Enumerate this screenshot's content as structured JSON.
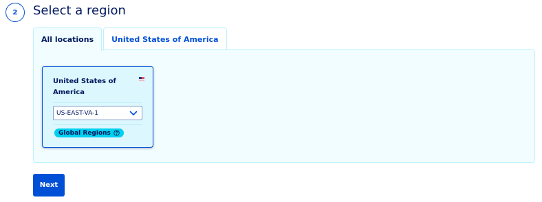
{
  "step": {
    "number": "2",
    "title": "Select a region"
  },
  "tabs": [
    {
      "label": "All locations",
      "active": true
    },
    {
      "label": "United States of America",
      "active": false
    }
  ],
  "region_card": {
    "title": "United States of America",
    "flag_icon": "us-flag-icon",
    "selected_value": "US-EAST-VA-1",
    "dropdown_icon": "chevron-down-icon",
    "badge_label": "Global Regions",
    "badge_icon": "question-circle-icon"
  },
  "actions": {
    "next_label": "Next"
  },
  "colors": {
    "primary": "#0050d7",
    "text": "#00185e",
    "panel_bg": "#f2fdff",
    "panel_border": "#bef1ff",
    "card_bg": "#dcf7fd",
    "badge_bg": "#00d1f0"
  }
}
